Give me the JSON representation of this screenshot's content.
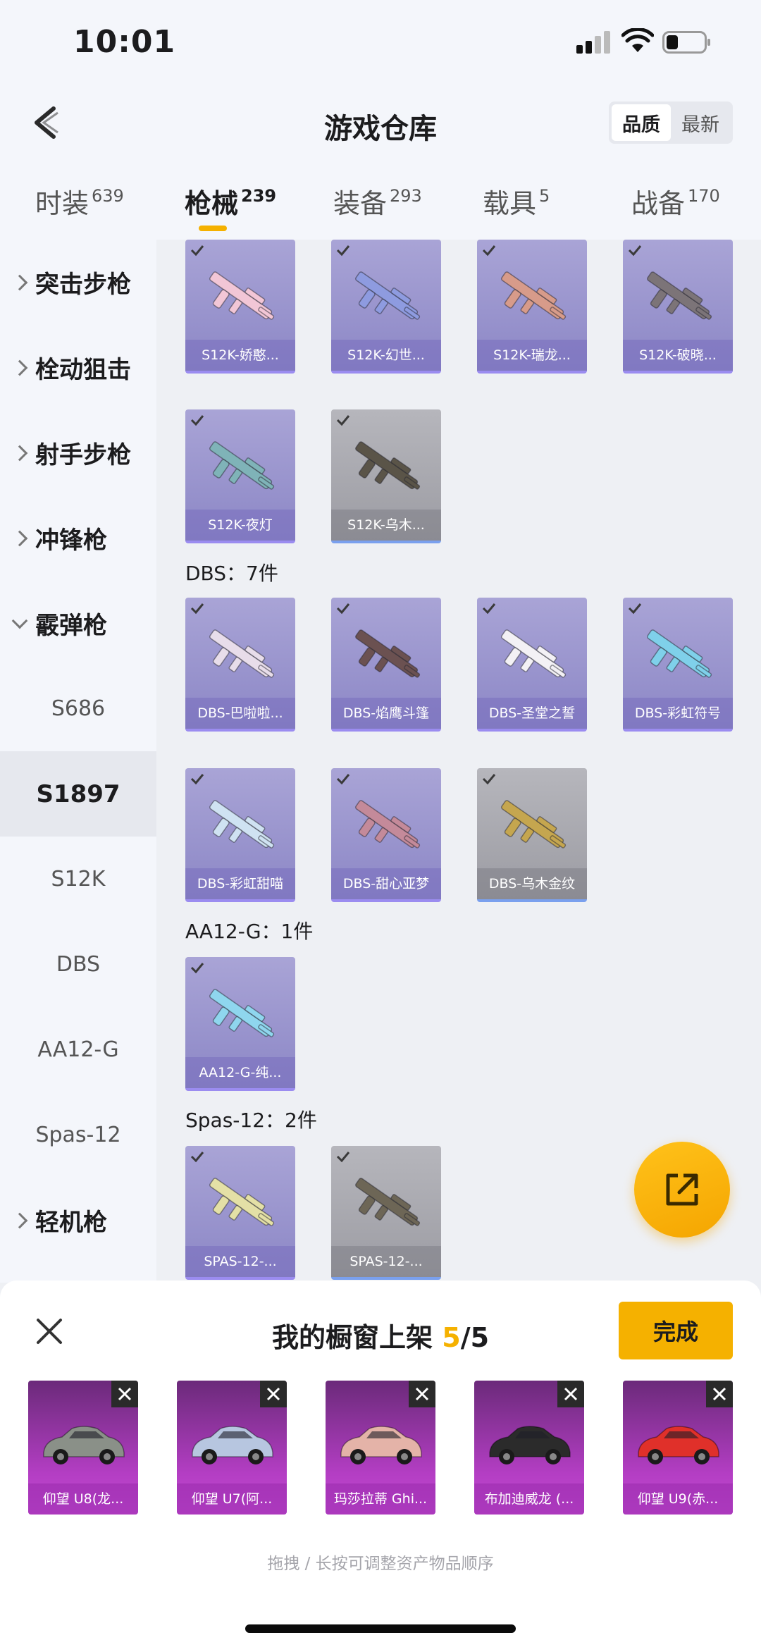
{
  "status_bar": {
    "time": "10:01"
  },
  "header": {
    "title": "游戏仓库",
    "sort_options": [
      {
        "label": "品质",
        "active": true
      },
      {
        "label": "最新",
        "active": false
      }
    ]
  },
  "tabs": [
    {
      "label": "时装",
      "count": "639"
    },
    {
      "label": "枪械",
      "count": "239",
      "active": true
    },
    {
      "label": "装备",
      "count": "293"
    },
    {
      "label": "载具",
      "count": "5"
    },
    {
      "label": "战备",
      "count": "170"
    }
  ],
  "sidebar": {
    "items": [
      {
        "label": "突击步枪",
        "kind": "category"
      },
      {
        "label": "栓动狙击",
        "kind": "category"
      },
      {
        "label": "射手步枪",
        "kind": "category"
      },
      {
        "label": "冲锋枪",
        "kind": "category"
      },
      {
        "label": "霰弹枪",
        "kind": "category",
        "open": true
      },
      {
        "label": "S686",
        "kind": "sub"
      },
      {
        "label": "S1897",
        "kind": "sub",
        "active": true
      },
      {
        "label": "S12K",
        "kind": "sub"
      },
      {
        "label": "DBS",
        "kind": "sub"
      },
      {
        "label": "AA12-G",
        "kind": "sub"
      },
      {
        "label": "Spas-12",
        "kind": "sub"
      },
      {
        "label": "轻机枪",
        "kind": "category"
      }
    ]
  },
  "groups": [
    {
      "title": "",
      "items": [
        {
          "label": "S12K-娇憨...",
          "rarity": "purple",
          "gun_color": "#f2c6d6"
        },
        {
          "label": "S12K-幻世...",
          "rarity": "purple",
          "gun_color": "#8e9be0"
        },
        {
          "label": "S12K-瑞龙...",
          "rarity": "purple",
          "gun_color": "#d79b8a"
        },
        {
          "label": "S12K-破晓...",
          "rarity": "purple",
          "gun_color": "#7c7478"
        },
        {
          "label": "S12K-夜灯",
          "rarity": "purple",
          "gun_color": "#7fb3b8"
        },
        {
          "label": "S12K-乌木...",
          "rarity": "gray",
          "gun_color": "#5a5448"
        }
      ]
    },
    {
      "title": "DBS：7件",
      "items": [
        {
          "label": "DBS-巴啦啦...",
          "rarity": "purple",
          "gun_color": "#e8ddea"
        },
        {
          "label": "DBS-焰鹰斗篷",
          "rarity": "purple",
          "gun_color": "#6b5151"
        },
        {
          "label": "DBS-圣堂之誓",
          "rarity": "purple",
          "gun_color": "#f3f1f5"
        },
        {
          "label": "DBS-彩虹符号",
          "rarity": "purple",
          "gun_color": "#7fd0ea"
        },
        {
          "label": "DBS-彩虹甜喵",
          "rarity": "purple",
          "gun_color": "#cfe2f2"
        },
        {
          "label": "DBS-甜心亚梦",
          "rarity": "purple",
          "gun_color": "#c48a9a"
        },
        {
          "label": "DBS-乌木金纹",
          "rarity": "gray",
          "gun_color": "#c5a64f"
        }
      ]
    },
    {
      "title": "AA12-G：1件",
      "items": [
        {
          "label": "AA12-G-纯...",
          "rarity": "purple",
          "gun_color": "#8fd6ee"
        }
      ]
    },
    {
      "title": "Spas-12：2件",
      "items": [
        {
          "label": "SPAS-12-...",
          "rarity": "purple",
          "gun_color": "#e4e0a6"
        },
        {
          "label": "SPAS-12-...",
          "rarity": "gray",
          "gun_color": "#6d6656"
        }
      ]
    }
  ],
  "showcase": {
    "title": "我的橱窗上架",
    "count": "5",
    "total": "/5",
    "done_label": "完成",
    "hint": "拖拽 / 长按可调整资产物品顺序",
    "items": [
      {
        "label": "仰望 U8(龙...",
        "car_color": "#8a9088"
      },
      {
        "label": "仰望 U7(阿...",
        "car_color": "#b7c6e0"
      },
      {
        "label": "玛莎拉蒂 Ghi...",
        "car_color": "#e4b3a8"
      },
      {
        "label": "布加迪威龙 (...",
        "car_color": "#2b2b2b"
      },
      {
        "label": "仰望 U9(赤...",
        "car_color": "#e0302a"
      }
    ]
  }
}
